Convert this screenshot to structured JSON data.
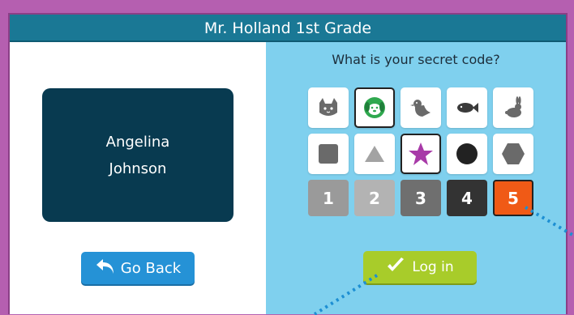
{
  "window": {
    "title": "Mr. Holland 1st Grade"
  },
  "student": {
    "first_name": "Angelina",
    "last_name": "Johnson"
  },
  "buttons": {
    "go_back": "Go Back",
    "log_in": "Log in"
  },
  "prompt": "What is your secret code?",
  "animals": [
    {
      "icon": "cat-icon",
      "selected": false
    },
    {
      "icon": "dog-icon",
      "selected": true
    },
    {
      "icon": "bird-icon",
      "selected": false
    },
    {
      "icon": "fish-icon",
      "selected": false
    },
    {
      "icon": "rabbit-icon",
      "selected": false
    }
  ],
  "shapes": [
    {
      "icon": "square-icon",
      "selected": false
    },
    {
      "icon": "triangle-icon",
      "selected": false
    },
    {
      "icon": "star-icon",
      "selected": true
    },
    {
      "icon": "circle-icon",
      "selected": false
    },
    {
      "icon": "hexagon-icon",
      "selected": false
    }
  ],
  "numbers": [
    {
      "label": "1",
      "color": "#9a9a9a",
      "selected": false
    },
    {
      "label": "2",
      "color": "#b3b3b3",
      "selected": false
    },
    {
      "label": "3",
      "color": "#6f6f6f",
      "selected": false
    },
    {
      "label": "4",
      "color": "#333333",
      "selected": false
    },
    {
      "label": "5",
      "color": "#f05a16",
      "selected": true
    }
  ],
  "colors": {
    "title_bar": "#1a7895",
    "right_pane": "#7fd0ee",
    "name_card": "#083a50",
    "go_back": "#2592d6",
    "log_in": "#a8cc2a",
    "star": "#a83aa8",
    "dog": "#2fa84f"
  }
}
